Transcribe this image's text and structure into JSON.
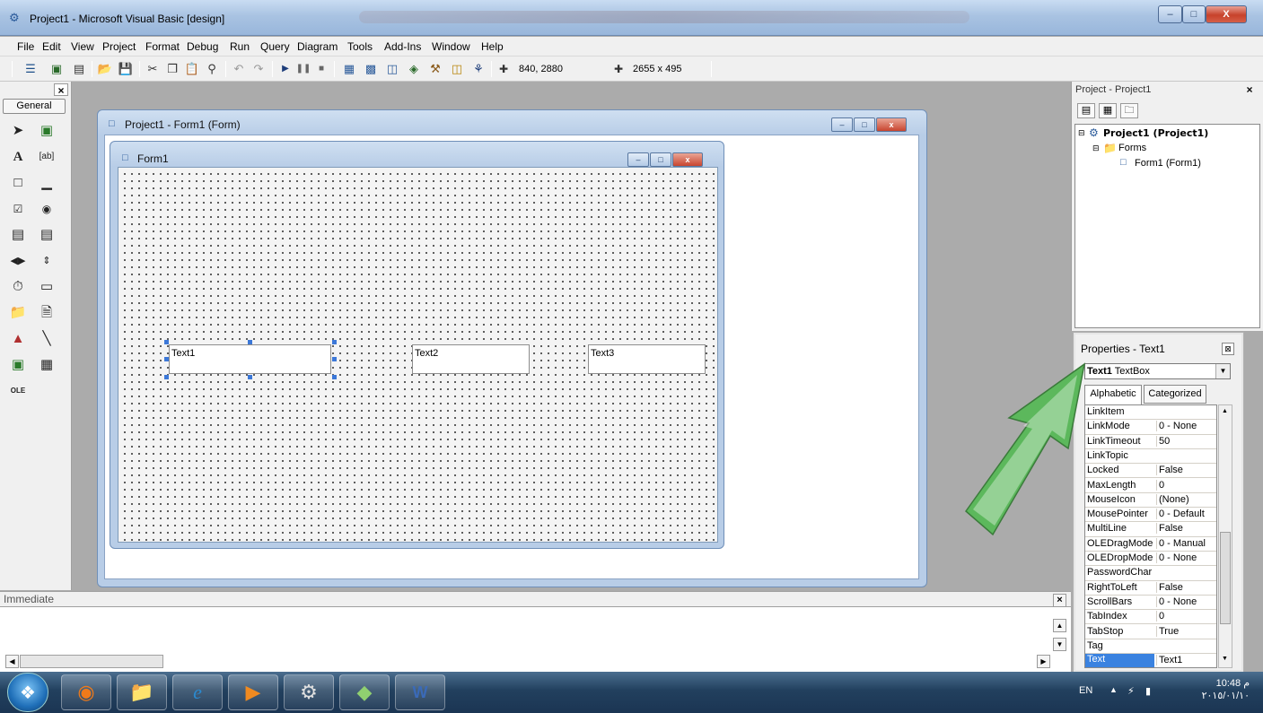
{
  "window": {
    "title": "Project1 - Microsoft Visual Basic [design]",
    "min_glyph": "–",
    "max_glyph": "□",
    "close_glyph": "X"
  },
  "menu": [
    "File",
    "Edit",
    "View",
    "Project",
    "Format",
    "Debug",
    "Run",
    "Query",
    "Diagram",
    "Tools",
    "Add-Ins",
    "Window",
    "Help"
  ],
  "toolbar": {
    "position": "840, 2880",
    "size": "2655 x 495"
  },
  "toolbox": {
    "tab_label": "General",
    "close_glyph": "×"
  },
  "designer": {
    "title": "Project1 - Form1 (Form)"
  },
  "form": {
    "caption": "Form1",
    "textboxes": [
      "Text1",
      "Text2",
      "Text3"
    ]
  },
  "project_explorer": {
    "title": "Project - Project1",
    "close_glyph": "×",
    "nodes": {
      "project": "Project1 (Project1)",
      "folder": "Forms",
      "form": "Form1 (Form1)"
    }
  },
  "properties": {
    "title": "Properties - Text1",
    "object_name": "Text1",
    "object_type": "TextBox",
    "tabs": [
      "Alphabetic",
      "Categorized"
    ],
    "rows": [
      {
        "name": "LinkItem",
        "value": ""
      },
      {
        "name": "LinkMode",
        "value": "0 - None"
      },
      {
        "name": "LinkTimeout",
        "value": "50"
      },
      {
        "name": "LinkTopic",
        "value": ""
      },
      {
        "name": "Locked",
        "value": "False"
      },
      {
        "name": "MaxLength",
        "value": "0"
      },
      {
        "name": "MouseIcon",
        "value": "(None)"
      },
      {
        "name": "MousePointer",
        "value": "0 - Default"
      },
      {
        "name": "MultiLine",
        "value": "False"
      },
      {
        "name": "OLEDragMode",
        "value": "0 - Manual"
      },
      {
        "name": "OLEDropMode",
        "value": "0 - None"
      },
      {
        "name": "PasswordChar",
        "value": ""
      },
      {
        "name": "RightToLeft",
        "value": "False"
      },
      {
        "name": "ScrollBars",
        "value": "0 - None"
      },
      {
        "name": "TabIndex",
        "value": "0"
      },
      {
        "name": "TabStop",
        "value": "True"
      },
      {
        "name": "Tag",
        "value": ""
      },
      {
        "name": "Text",
        "value": "Text1"
      }
    ],
    "selected": "Text"
  },
  "immediate": {
    "title": "Immediate"
  },
  "taskbar": {
    "language": "EN",
    "time": "10:48 م",
    "date": "٢٠١٥/٠١/١٠"
  },
  "colors": {
    "accent_arrow": "#5cb85c",
    "selection": "#3a82e0"
  }
}
